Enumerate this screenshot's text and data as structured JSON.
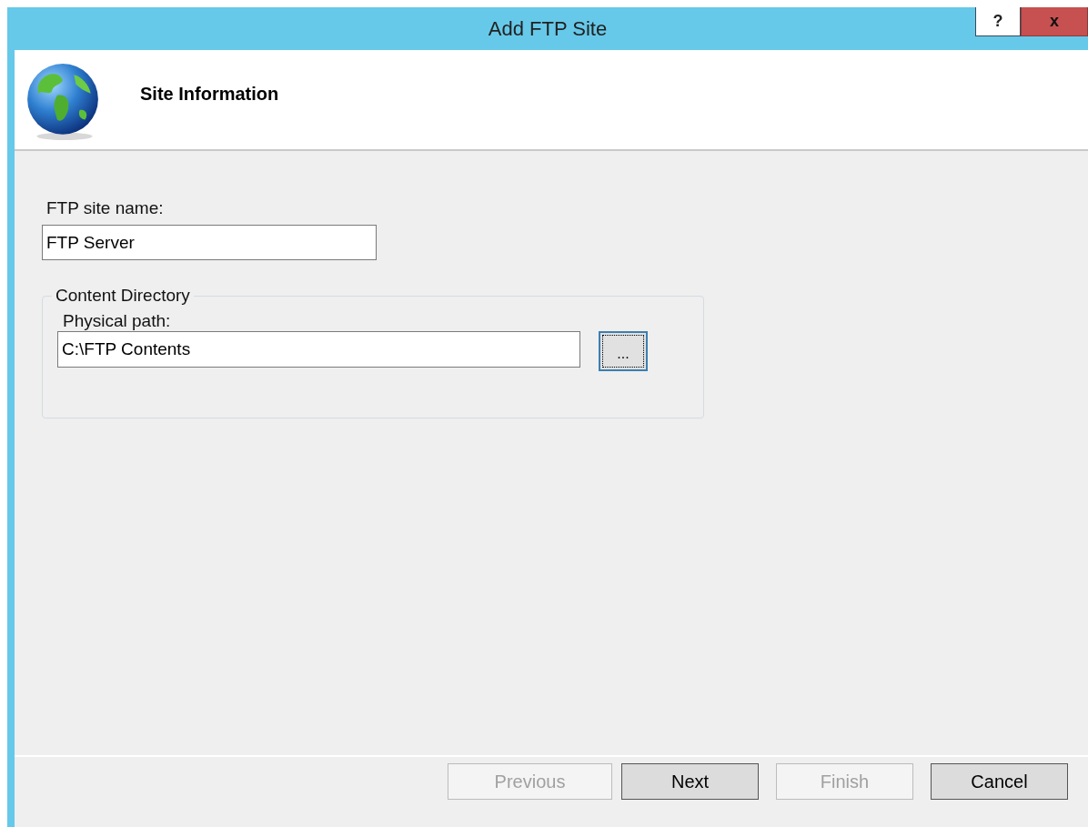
{
  "window": {
    "title": "Add FTP Site",
    "controls": [
      "?",
      "x"
    ]
  },
  "header": {
    "title": "Site Information"
  },
  "site_name": {
    "label": "FTP site name:",
    "value": "FTP Server"
  },
  "content_directory": {
    "legend": "Content Directory",
    "path_label": "Physical path:",
    "path_value": "C:\\FTP Contents",
    "browse": {
      "label": "...",
      "focused": true
    }
  },
  "buttons": [
    {
      "label": "Previous",
      "disabled": true
    },
    {
      "label": "Next",
      "disabled": false
    },
    {
      "label": "Finish",
      "disabled": true
    },
    {
      "label": "Cancel",
      "disabled": false
    }
  ]
}
